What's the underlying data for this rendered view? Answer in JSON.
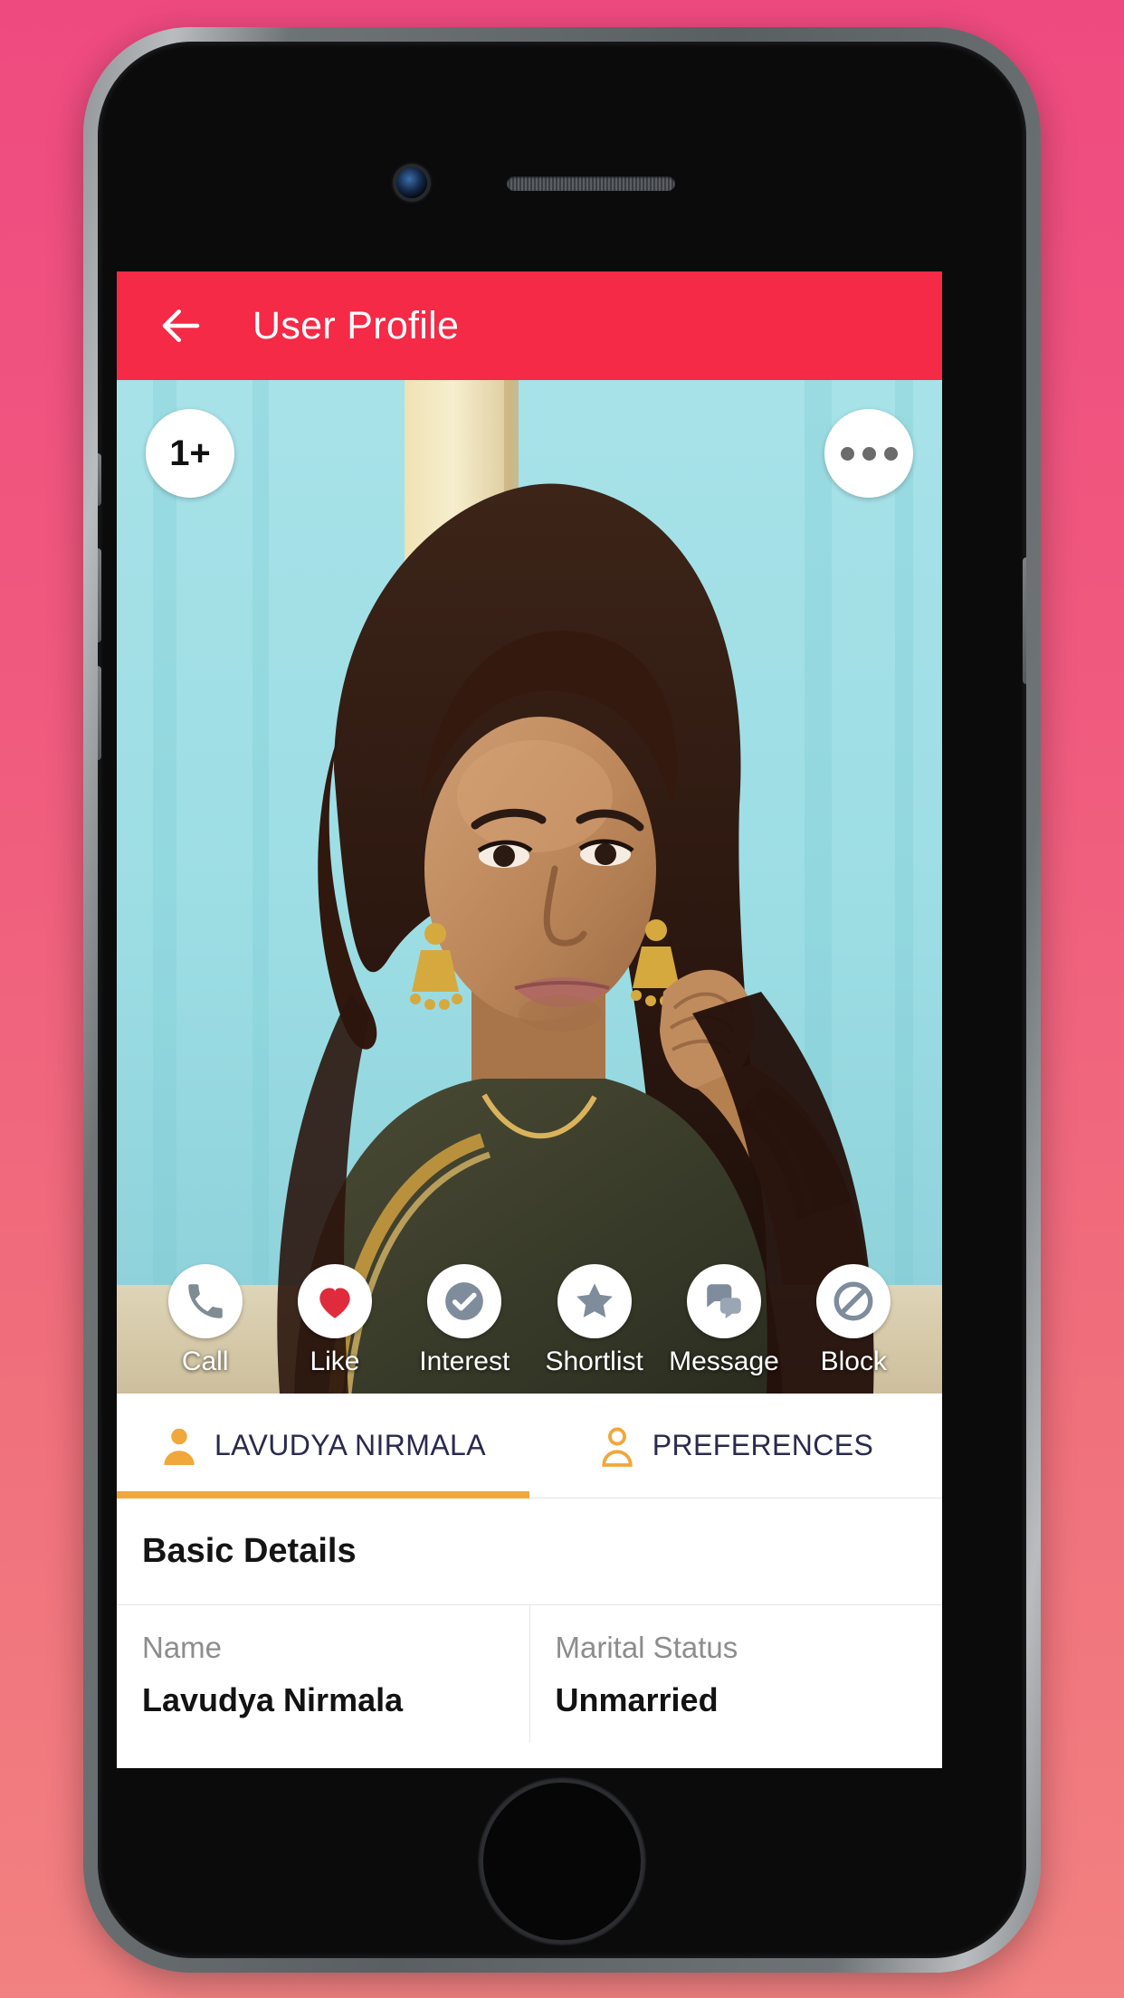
{
  "app_bar": {
    "title": "User Profile",
    "back_icon": "arrow-left-icon",
    "background_color": "#f42a46"
  },
  "photo": {
    "count_badge": "1+",
    "more_icon": "overflow-menu-icon",
    "alt": "profile photo of woman in dark green saree against teal curtain"
  },
  "actions": [
    {
      "label": "Call",
      "icon": "phone-icon",
      "color": "#7f8c94"
    },
    {
      "label": "Like",
      "icon": "heart-icon",
      "color": "#e02b3d"
    },
    {
      "label": "Interest",
      "icon": "check-circle-icon",
      "color": "#7f8c9c"
    },
    {
      "label": "Shortlist",
      "icon": "star-icon",
      "color": "#7f8c9c"
    },
    {
      "label": "Message",
      "icon": "chat-bubbles-icon",
      "color": "#7f8c9c"
    },
    {
      "label": "Block",
      "icon": "block-icon",
      "color": "#7f8c9c"
    }
  ],
  "tabs": [
    {
      "label": "LAVUDYA NIRMALA",
      "icon": "person-filled-icon",
      "active": true
    },
    {
      "label": "PREFERENCES",
      "icon": "person-outline-icon",
      "active": false
    }
  ],
  "tab_accent_color": "#f0a73b",
  "details": {
    "section_title": "Basic Details",
    "fields": [
      {
        "label": "Name",
        "value": "Lavudya Nirmala"
      },
      {
        "label": "Marital Status",
        "value": "Unmarried"
      }
    ]
  }
}
